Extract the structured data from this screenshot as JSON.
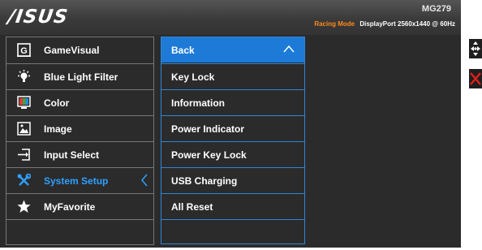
{
  "header": {
    "brand": "/ISUS",
    "registered": "®",
    "model": "MG279",
    "mode": "Racing Mode",
    "signal": "DisplayPort  2560x1440 @ 60Hz"
  },
  "menu": {
    "items": [
      {
        "label": "GameVisual",
        "icon": "gamevisual-icon"
      },
      {
        "label": "Blue Light Filter",
        "icon": "blue-light-icon"
      },
      {
        "label": "Color",
        "icon": "color-icon"
      },
      {
        "label": "Image",
        "icon": "image-icon"
      },
      {
        "label": "Input Select",
        "icon": "input-select-icon"
      },
      {
        "label": "System Setup",
        "icon": "wrench-icon",
        "active": true
      },
      {
        "label": "MyFavorite",
        "icon": "star-icon"
      },
      {
        "label": "",
        "icon": ""
      }
    ]
  },
  "submenu": {
    "items": [
      {
        "label": "Back",
        "selected": true
      },
      {
        "label": "Key Lock"
      },
      {
        "label": "Information"
      },
      {
        "label": "Power Indicator"
      },
      {
        "label": "Power Key Lock"
      },
      {
        "label": "USB Charging"
      },
      {
        "label": "All Reset"
      },
      {
        "label": ""
      }
    ]
  },
  "colors": {
    "accent": "#2ea0ff",
    "selection": "#1d7ad6",
    "mode": "#ff8a1c",
    "close": "#e0201e"
  },
  "side_buttons": [
    "navigate-icon",
    "close-icon"
  ]
}
